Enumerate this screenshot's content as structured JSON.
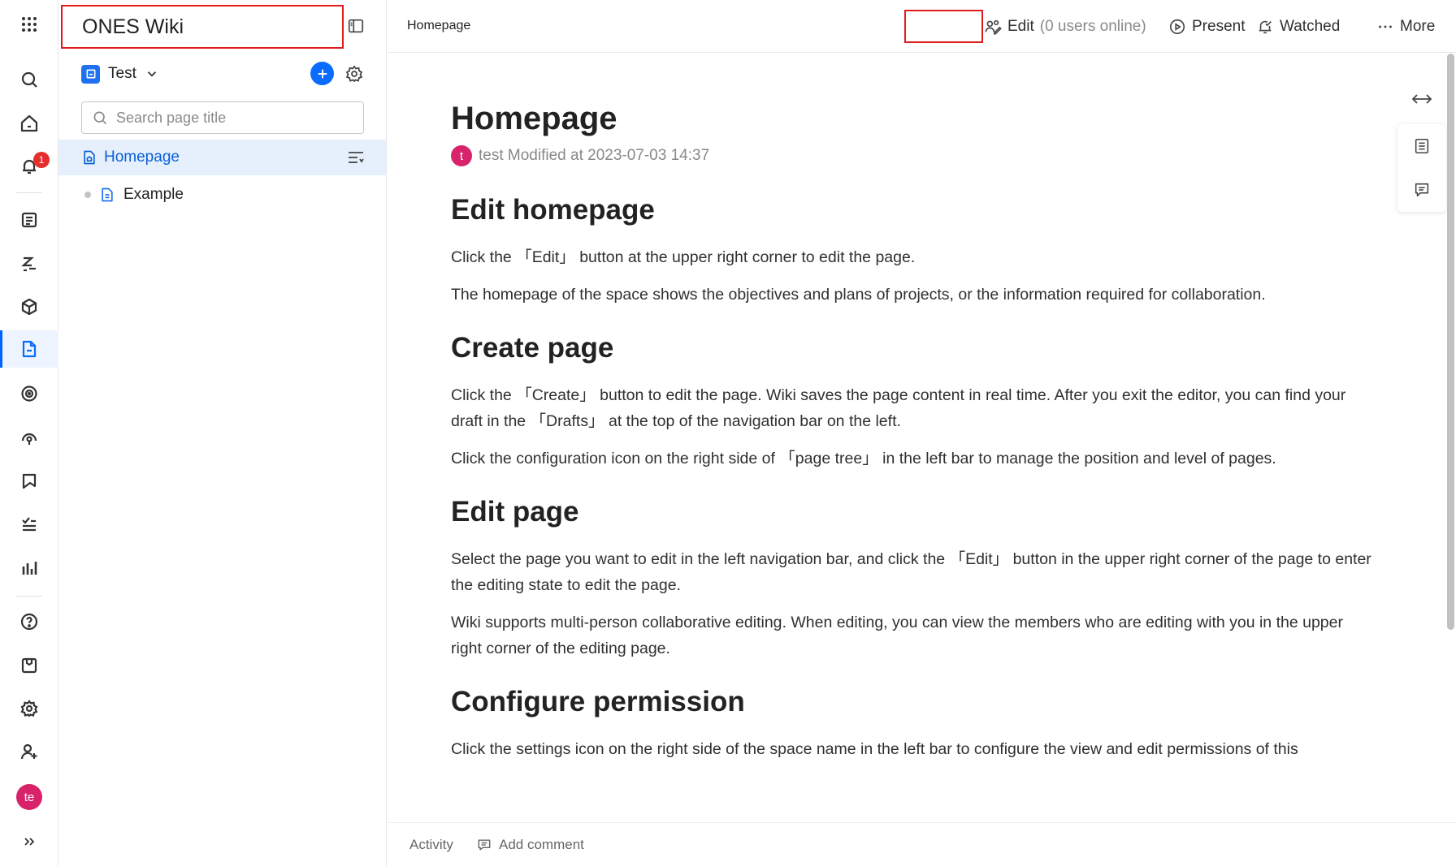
{
  "rail": {
    "notification_count": "1",
    "avatar_initials": "te",
    "icons": [
      "apps-grid-icon",
      "search-icon",
      "home-icon",
      "bell-icon",
      "project-icon",
      "test-case-icon",
      "cube-icon",
      "wiki-icon",
      "target-icon",
      "rocket-icon",
      "pipeline-icon",
      "checklist-icon",
      "analytics-icon",
      "help-icon",
      "inbox-icon",
      "settings-icon",
      "add-user-icon",
      "expand-icon"
    ]
  },
  "sidebar": {
    "title": "ONES Wiki",
    "space_name": "Test",
    "search_placeholder": "Search page title",
    "tree": [
      {
        "label": "Homepage",
        "active": true
      },
      {
        "label": "Example",
        "active": false
      }
    ]
  },
  "topbar": {
    "breadcrumb": "Homepage",
    "edit_label": "Edit",
    "online_text": "(0 users online)",
    "present_label": "Present",
    "watched_label": "Watched",
    "more_label": "More"
  },
  "doc": {
    "title": "Homepage",
    "author_initial": "t",
    "meta_text": "test Modified at 2023-07-03 14:37",
    "sections": [
      {
        "heading": "Edit homepage",
        "paragraphs": [
          "Click the 「Edit」 button at the upper right corner to edit the page.",
          "The homepage of the space shows the objectives and plans of projects, or the information required for collaboration."
        ]
      },
      {
        "heading": "Create page",
        "paragraphs": [
          "Click the 「Create」 button to edit the page. Wiki saves the page content in real time. After you exit the editor, you can find your draft in the 「Drafts」 at the top of the navigation bar on the left.",
          "Click the configuration icon on the right side of 「page tree」 in the left bar to manage the position and level of pages."
        ]
      },
      {
        "heading": "Edit page",
        "paragraphs": [
          "Select the page you want to edit in the left navigation bar, and click the 「Edit」 button in the upper right corner of the page to enter the editing state to edit the page.",
          "Wiki supports multi-person collaborative editing. When editing, you can view the members who are editing with you in the upper right corner of the editing page."
        ]
      },
      {
        "heading": "Configure permission",
        "paragraphs": [
          "Click the settings icon on the right side of the space name in the left bar to configure the view and edit permissions of this"
        ]
      }
    ]
  },
  "bottombar": {
    "activity_label": "Activity",
    "comment_label": "Add comment"
  },
  "colors": {
    "accent": "#0a6cff",
    "highlight_box": "#e0191f",
    "active_row_bg": "#e6f0fd",
    "badge": "#e52e2e",
    "avatar": "#d8236b"
  }
}
